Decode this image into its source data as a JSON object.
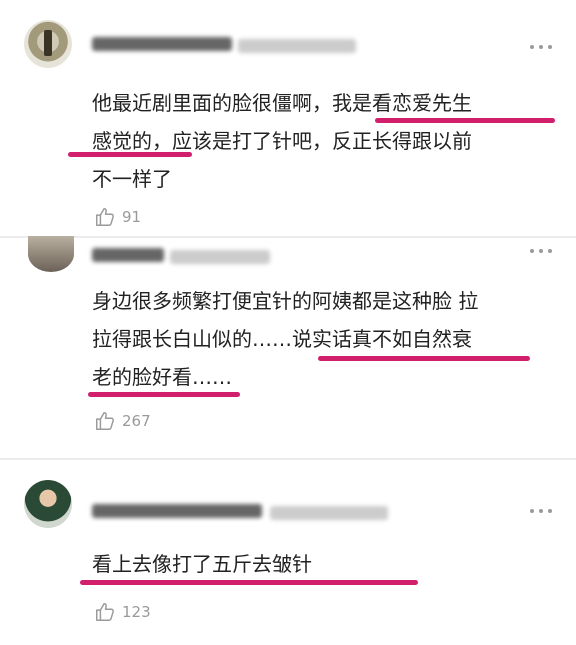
{
  "comments": [
    {
      "lines": [
        "他最近剧里面的脸很僵啊，我是看恋爱先生",
        "感觉的，应该是打了针吧，反正长得跟以前",
        "不一样了"
      ],
      "likes": "91"
    },
    {
      "lines": [
        "身边很多频繁打便宜针的阿姨都是这种脸 拉",
        "拉得跟长白山似的……说实话真不如自然衰",
        "老的脸好看……"
      ],
      "likes": "267"
    },
    {
      "lines": [
        "看上去像打了五斤去皱针"
      ],
      "likes": "123"
    }
  ],
  "colors": {
    "highlight": "#d11f6c",
    "meta_gray": "#9a9a9a",
    "text": "#222222"
  },
  "icons": {
    "like": "thumbs-up-icon",
    "more": "more-dots-icon"
  }
}
